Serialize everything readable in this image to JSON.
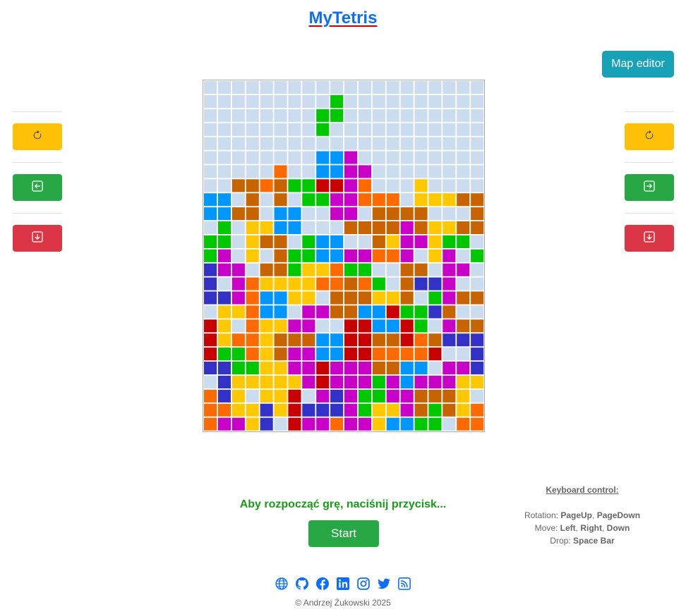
{
  "header": {
    "title": "MyTetris"
  },
  "toolbar": {
    "map_editor_label": "Map editor"
  },
  "controls": {
    "buttons": [
      {
        "action": "rotate",
        "icon": "rotate-icon",
        "color": "#ffc107"
      },
      {
        "action": "move",
        "icon": "arrow-box-icon",
        "color": "#28a745"
      },
      {
        "action": "drop",
        "icon": "arrow-down-box-icon",
        "color": "#dc3545"
      }
    ]
  },
  "board": {
    "columns": 20,
    "rows": 25,
    "colors": {
      "e": "#ccdcef",
      "G": "#00c800",
      "B": "#0096ff",
      "P": "#c800c8",
      "O": "#ff6a00",
      "B2": "#c86400",
      "Y": "#ffc800",
      "R": "#c80000",
      "N": "#3232c8"
    },
    "grid": [
      "eeeeeeeeeeeeeeeeeeee",
      "eeeeeeeeeGeeeeeeeeee",
      "eeeeeeeeGGeeeeeeeeee",
      "eeeeeeeeGeeeeeeeeeee",
      "eeeeeeeeeeeeeeeeeeee",
      "eeeeeeeeBBPeeeeeeeee",
      "eeeeeOeeBBPPeeeeeeee",
      "eeDDODGGRRPOeeeYeeee",
      "BBeDeDeGGPPOOOeYYYDD",
      "BBDDeBBeePPeDDDDeeeD",
      "eGeYYBBeeeDDDDPDYYDD",
      "GGeYDDeGBBeeDYPPYGGe",
      "GPeYeDGGBBPPOOPeYPeG",
      "NPPeDDGYYOGGeeDDePPe",
      "NePOYYYYOODOGeDNNPee",
      "NNPOBBYYeDDDYYDeGPDD",
      "eYYOBBePPDDBBRGGNDee",
      "RYeOYYPPeeRRBBRGePDD",
      "RYOOYDDDBBRRDDRODNNN",
      "RGGOYDPPBBRROOOOReeN",
      "NNGGYYPPRPPPDDBBePPN",
      "eNYYYYYPRPPPGPBPPPYY",
      "ONYeYYRePNPGGPPDDDYe",
      "OOYYNYRNNNPGYYPDGDYO",
      "OPPYNeRPPOPPYBBGGeOO"
    ]
  },
  "status": {
    "message": "Aby rozpocząć grę, naciśnij przycisk..."
  },
  "start": {
    "label": "Start"
  },
  "keyboard": {
    "title": "Keyboard control:",
    "rotation_label": "Rotation: ",
    "rotation_keys": [
      "PageUp",
      "PageDown"
    ],
    "move_label": "Move: ",
    "move_keys": [
      "Left",
      "Right",
      "Down"
    ],
    "drop_label": "Drop: ",
    "drop_key": "Space Bar"
  },
  "footer": {
    "links": [
      "globe-icon",
      "github-icon",
      "facebook-icon",
      "linkedin-icon",
      "instagram-icon",
      "twitter-icon",
      "rss-icon"
    ],
    "copyright": "© Andrzej Żukowski 2025"
  }
}
